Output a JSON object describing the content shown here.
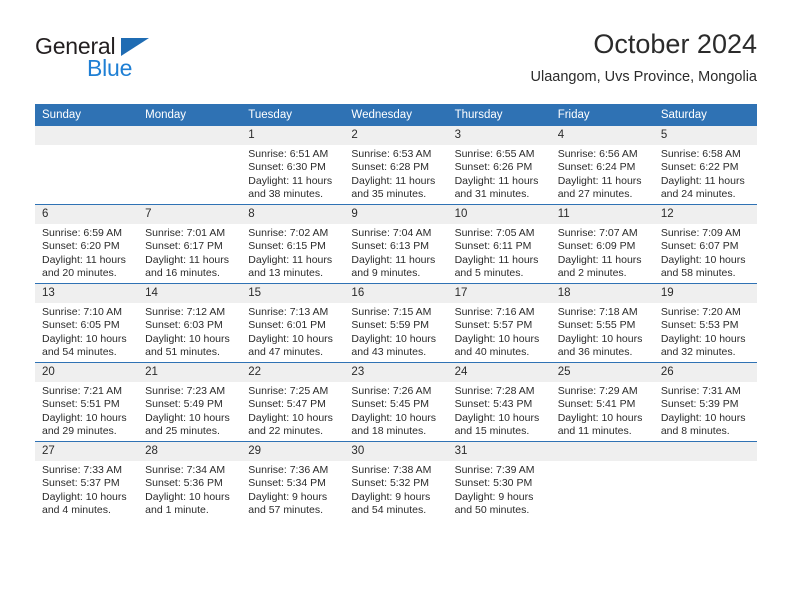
{
  "brand": {
    "name_top": "General",
    "name_bottom": "Blue",
    "accent_dark_blue": "#1f6cb3",
    "accent_light_blue": "#1f7fd4"
  },
  "header": {
    "title": "October 2024",
    "subtitle": "Ulaangom, Uvs Province, Mongolia",
    "header_bg": "#2f72b4",
    "daynum_bg": "#efefef"
  },
  "weekdays": [
    "Sunday",
    "Monday",
    "Tuesday",
    "Wednesday",
    "Thursday",
    "Friday",
    "Saturday"
  ],
  "labels": {
    "sunrise": "Sunrise:",
    "sunset": "Sunset:",
    "daylight": "Daylight:"
  },
  "weeks": [
    [
      {
        "day": "",
        "empty": true
      },
      {
        "day": "",
        "empty": true
      },
      {
        "day": "1",
        "sunrise": "Sunrise: 6:51 AM",
        "sunset": "Sunset: 6:30 PM",
        "daylight_l1": "Daylight: 11 hours",
        "daylight_l2": "and 38 minutes."
      },
      {
        "day": "2",
        "sunrise": "Sunrise: 6:53 AM",
        "sunset": "Sunset: 6:28 PM",
        "daylight_l1": "Daylight: 11 hours",
        "daylight_l2": "and 35 minutes."
      },
      {
        "day": "3",
        "sunrise": "Sunrise: 6:55 AM",
        "sunset": "Sunset: 6:26 PM",
        "daylight_l1": "Daylight: 11 hours",
        "daylight_l2": "and 31 minutes."
      },
      {
        "day": "4",
        "sunrise": "Sunrise: 6:56 AM",
        "sunset": "Sunset: 6:24 PM",
        "daylight_l1": "Daylight: 11 hours",
        "daylight_l2": "and 27 minutes."
      },
      {
        "day": "5",
        "sunrise": "Sunrise: 6:58 AM",
        "sunset": "Sunset: 6:22 PM",
        "daylight_l1": "Daylight: 11 hours",
        "daylight_l2": "and 24 minutes."
      }
    ],
    [
      {
        "day": "6",
        "sunrise": "Sunrise: 6:59 AM",
        "sunset": "Sunset: 6:20 PM",
        "daylight_l1": "Daylight: 11 hours",
        "daylight_l2": "and 20 minutes."
      },
      {
        "day": "7",
        "sunrise": "Sunrise: 7:01 AM",
        "sunset": "Sunset: 6:17 PM",
        "daylight_l1": "Daylight: 11 hours",
        "daylight_l2": "and 16 minutes."
      },
      {
        "day": "8",
        "sunrise": "Sunrise: 7:02 AM",
        "sunset": "Sunset: 6:15 PM",
        "daylight_l1": "Daylight: 11 hours",
        "daylight_l2": "and 13 minutes."
      },
      {
        "day": "9",
        "sunrise": "Sunrise: 7:04 AM",
        "sunset": "Sunset: 6:13 PM",
        "daylight_l1": "Daylight: 11 hours",
        "daylight_l2": "and 9 minutes."
      },
      {
        "day": "10",
        "sunrise": "Sunrise: 7:05 AM",
        "sunset": "Sunset: 6:11 PM",
        "daylight_l1": "Daylight: 11 hours",
        "daylight_l2": "and 5 minutes."
      },
      {
        "day": "11",
        "sunrise": "Sunrise: 7:07 AM",
        "sunset": "Sunset: 6:09 PM",
        "daylight_l1": "Daylight: 11 hours",
        "daylight_l2": "and 2 minutes."
      },
      {
        "day": "12",
        "sunrise": "Sunrise: 7:09 AM",
        "sunset": "Sunset: 6:07 PM",
        "daylight_l1": "Daylight: 10 hours",
        "daylight_l2": "and 58 minutes."
      }
    ],
    [
      {
        "day": "13",
        "sunrise": "Sunrise: 7:10 AM",
        "sunset": "Sunset: 6:05 PM",
        "daylight_l1": "Daylight: 10 hours",
        "daylight_l2": "and 54 minutes."
      },
      {
        "day": "14",
        "sunrise": "Sunrise: 7:12 AM",
        "sunset": "Sunset: 6:03 PM",
        "daylight_l1": "Daylight: 10 hours",
        "daylight_l2": "and 51 minutes."
      },
      {
        "day": "15",
        "sunrise": "Sunrise: 7:13 AM",
        "sunset": "Sunset: 6:01 PM",
        "daylight_l1": "Daylight: 10 hours",
        "daylight_l2": "and 47 minutes."
      },
      {
        "day": "16",
        "sunrise": "Sunrise: 7:15 AM",
        "sunset": "Sunset: 5:59 PM",
        "daylight_l1": "Daylight: 10 hours",
        "daylight_l2": "and 43 minutes."
      },
      {
        "day": "17",
        "sunrise": "Sunrise: 7:16 AM",
        "sunset": "Sunset: 5:57 PM",
        "daylight_l1": "Daylight: 10 hours",
        "daylight_l2": "and 40 minutes."
      },
      {
        "day": "18",
        "sunrise": "Sunrise: 7:18 AM",
        "sunset": "Sunset: 5:55 PM",
        "daylight_l1": "Daylight: 10 hours",
        "daylight_l2": "and 36 minutes."
      },
      {
        "day": "19",
        "sunrise": "Sunrise: 7:20 AM",
        "sunset": "Sunset: 5:53 PM",
        "daylight_l1": "Daylight: 10 hours",
        "daylight_l2": "and 32 minutes."
      }
    ],
    [
      {
        "day": "20",
        "sunrise": "Sunrise: 7:21 AM",
        "sunset": "Sunset: 5:51 PM",
        "daylight_l1": "Daylight: 10 hours",
        "daylight_l2": "and 29 minutes."
      },
      {
        "day": "21",
        "sunrise": "Sunrise: 7:23 AM",
        "sunset": "Sunset: 5:49 PM",
        "daylight_l1": "Daylight: 10 hours",
        "daylight_l2": "and 25 minutes."
      },
      {
        "day": "22",
        "sunrise": "Sunrise: 7:25 AM",
        "sunset": "Sunset: 5:47 PM",
        "daylight_l1": "Daylight: 10 hours",
        "daylight_l2": "and 22 minutes."
      },
      {
        "day": "23",
        "sunrise": "Sunrise: 7:26 AM",
        "sunset": "Sunset: 5:45 PM",
        "daylight_l1": "Daylight: 10 hours",
        "daylight_l2": "and 18 minutes."
      },
      {
        "day": "24",
        "sunrise": "Sunrise: 7:28 AM",
        "sunset": "Sunset: 5:43 PM",
        "daylight_l1": "Daylight: 10 hours",
        "daylight_l2": "and 15 minutes."
      },
      {
        "day": "25",
        "sunrise": "Sunrise: 7:29 AM",
        "sunset": "Sunset: 5:41 PM",
        "daylight_l1": "Daylight: 10 hours",
        "daylight_l2": "and 11 minutes."
      },
      {
        "day": "26",
        "sunrise": "Sunrise: 7:31 AM",
        "sunset": "Sunset: 5:39 PM",
        "daylight_l1": "Daylight: 10 hours",
        "daylight_l2": "and 8 minutes."
      }
    ],
    [
      {
        "day": "27",
        "sunrise": "Sunrise: 7:33 AM",
        "sunset": "Sunset: 5:37 PM",
        "daylight_l1": "Daylight: 10 hours",
        "daylight_l2": "and 4 minutes."
      },
      {
        "day": "28",
        "sunrise": "Sunrise: 7:34 AM",
        "sunset": "Sunset: 5:36 PM",
        "daylight_l1": "Daylight: 10 hours",
        "daylight_l2": "and 1 minute."
      },
      {
        "day": "29",
        "sunrise": "Sunrise: 7:36 AM",
        "sunset": "Sunset: 5:34 PM",
        "daylight_l1": "Daylight: 9 hours",
        "daylight_l2": "and 57 minutes."
      },
      {
        "day": "30",
        "sunrise": "Sunrise: 7:38 AM",
        "sunset": "Sunset: 5:32 PM",
        "daylight_l1": "Daylight: 9 hours",
        "daylight_l2": "and 54 minutes."
      },
      {
        "day": "31",
        "sunrise": "Sunrise: 7:39 AM",
        "sunset": "Sunset: 5:30 PM",
        "daylight_l1": "Daylight: 9 hours",
        "daylight_l2": "and 50 minutes."
      },
      {
        "day": "",
        "empty": true
      },
      {
        "day": "",
        "empty": true
      }
    ]
  ]
}
